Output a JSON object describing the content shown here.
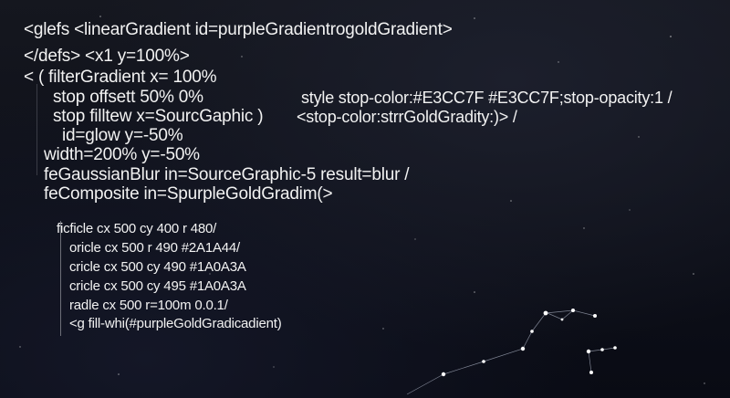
{
  "code_lines": [
    {
      "text": "<glefs   <linearGradient id=purpleGradientrogoldGradient>"
    },
    {
      "text": "</defs>  <x1 y=100%>"
    },
    {
      "text": "< ( filterGradient x= 100%"
    },
    {
      "text": "stop offsett 50% 0%"
    },
    {
      "text": "style stop-color:#E3CC7F #E3CC7F;stop-opacity:1 /"
    },
    {
      "text": "stop filltew    x=SourcGaphic )"
    },
    {
      "text": "<stop-color:strrGoldGradity:)> /"
    },
    {
      "text": "id=glow   y=-50%"
    },
    {
      "text": "width=200% y=-50%"
    },
    {
      "text": "feGaussianBlur in=SourceGraphic-5 result=blur /"
    },
    {
      "text": "feComposite in=SpurpleGoldGradim(>"
    }
  ],
  "inner_lines": [
    {
      "text": "ficficle cx 500 cy 400 r 480/"
    },
    {
      "text": "oricle cx 500 r 490  #2A1A44/"
    },
    {
      "text": "cricle cx 500 cy 490  #1A0A3A"
    },
    {
      "text": "cricle cx 500 cy 495  #1A0A3A"
    },
    {
      "text": "radle cx 500 r=100m    0.0.1/"
    },
    {
      "text": "<g fill-whi(#purpleGoldGradicadient)"
    }
  ],
  "colors": {
    "background": "#0f111a",
    "text": "#f2f2f2",
    "star": "#ffffff",
    "constellation_line": "#9aa0b0"
  }
}
